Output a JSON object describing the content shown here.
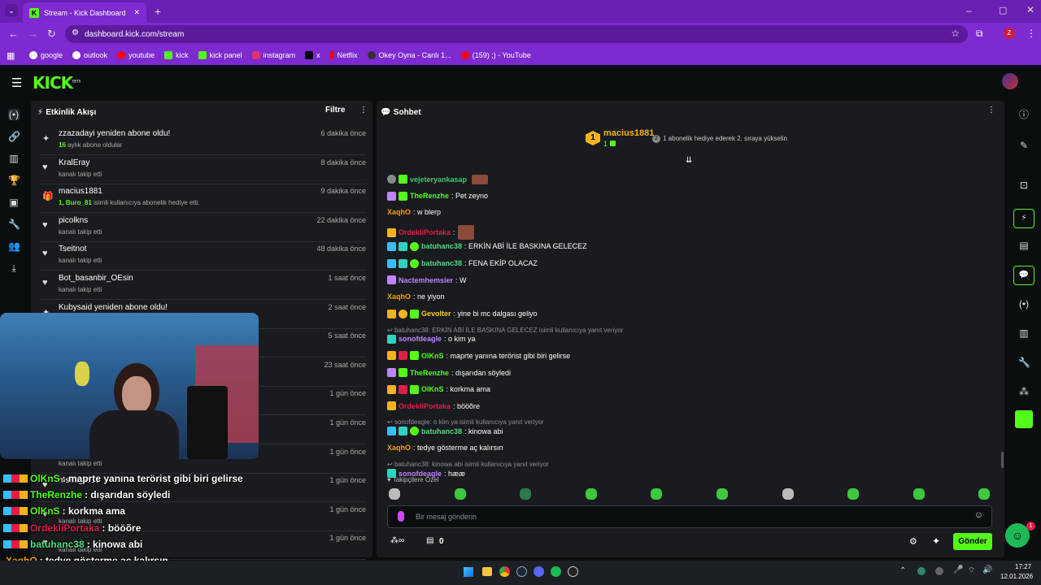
{
  "browser": {
    "tab_title": "Stream - Kick Dashboard",
    "url": "dashboard.kick.com/stream",
    "profile_initial": "Z",
    "bookmarks": [
      "google",
      "outlook",
      "youtube",
      "kick",
      "kick panel",
      "instagram",
      "x",
      "Netflix",
      "Okey Oyna - Canlı 1...",
      "(159) ;) - YouTube"
    ]
  },
  "brand": {
    "logo": "KICK",
    "beta": "BETA",
    "accent": "#53fc18"
  },
  "activity": {
    "title": "Etkinlik Akışı",
    "filter_label": "Filtre",
    "items": [
      {
        "name": "zzazadayi yeniden abone oldu!",
        "sub_strong": "16",
        "sub": " aylık abone oldular",
        "time": "6 dakika önce",
        "icon": "sparkle"
      },
      {
        "name": "KralEray",
        "sub_strong": "",
        "sub": "kanalı takip etti",
        "time": "8 dakika önce",
        "icon": "heart"
      },
      {
        "name": "macius1881",
        "sub_strong": "1, Buro_81",
        "sub": " isimli kullanıcıya abonelik hediye etti.",
        "time": "9 dakika önce",
        "icon": "gift"
      },
      {
        "name": "picolkns",
        "sub_strong": "",
        "sub": "kanalı takip etti",
        "time": "22 dakika önce",
        "icon": "heart"
      },
      {
        "name": "Tseitnot",
        "sub_strong": "",
        "sub": "kanalı takip etti",
        "time": "48 dakika önce",
        "icon": "heart"
      },
      {
        "name": "Bot_basanbir_OEsin",
        "sub_strong": "",
        "sub": "kanalı takip etti",
        "time": "1 saat önce",
        "icon": "heart"
      },
      {
        "name": "Kubysaid yeniden abone oldu!",
        "sub_strong": "",
        "sub": "",
        "time": "2 saat önce",
        "icon": "sparkle"
      },
      {
        "name": "",
        "sub_strong": "",
        "sub": "",
        "time": "5 saat önce",
        "icon": "heart"
      },
      {
        "name": "",
        "sub_strong": "",
        "sub": "",
        "time": "23 saat önce",
        "icon": "heart"
      },
      {
        "name": "",
        "sub_strong": "",
        "sub": "",
        "time": "1 gün önce",
        "icon": "heart"
      },
      {
        "name": "",
        "sub_strong": "",
        "sub": "",
        "time": "1 gün önce",
        "icon": "heart"
      },
      {
        "name": "",
        "sub_strong": "",
        "sub": "kanalı takip etti",
        "time": "1 gün önce",
        "icon": "heart"
      },
      {
        "name": "mstrsgim12",
        "sub_strong": "",
        "sub": "",
        "time": "1 gün önce",
        "icon": "heart"
      },
      {
        "name": "",
        "sub_strong": "",
        "sub": "kanalı takip etti",
        "time": "1 gün önce",
        "icon": "heart"
      },
      {
        "name": "",
        "sub_strong": "",
        "sub": "kanalı takip etti",
        "time": "1 gün önce",
        "icon": "heart"
      }
    ]
  },
  "chat": {
    "title": "Sohbet",
    "top_gifter": {
      "name": "macius1881",
      "rank": "1",
      "count": "1",
      "message": "1 abonelik hediye ederek 2. sıraya yükselin"
    },
    "messages": [
      {
        "user": "vejeteryankasap",
        "color": "#3ec86b",
        "text": "",
        "type": "msg"
      },
      {
        "user": "TheRenzhe",
        "color": "#53fc18",
        "text": ": Pet zeyno",
        "type": "msg"
      },
      {
        "user": "XaqhO",
        "color": "#f59e0b",
        "text": ": w blerp",
        "type": "msg"
      },
      {
        "user": "OrdekliPortaka",
        "color": "#e11d48",
        "text": ":",
        "type": "msg"
      },
      {
        "user": "batuhanc38",
        "color": "#4ade80",
        "text": ": ERKİN ABİ İLE BASKINA GELECEZ",
        "type": "msg"
      },
      {
        "user": "batuhanc38",
        "color": "#4ade80",
        "text": ": FENA EKİP OLACAZ",
        "type": "msg"
      },
      {
        "user": "Nactemhemsier",
        "color": "#c084fc",
        "text": ": W",
        "type": "msg"
      },
      {
        "user": "XaqhO",
        "color": "#f59e0b",
        "text": ": ne yiyon",
        "type": "msg"
      },
      {
        "user": "Gevolter",
        "color": "#facc15",
        "text": ": yine bi mc dalgası geliyo",
        "type": "msg"
      },
      {
        "user": "",
        "color": "",
        "text": "batuhanc38: ERKİN ABİ İLE BASKINA GELECEZ isimli kullanıcıya yanıt veriyor",
        "type": "reply"
      },
      {
        "user": "sonofdeagle",
        "color": "#c084fc",
        "text": ": o kim ya",
        "type": "msg"
      },
      {
        "user": "OlKnS",
        "color": "#53fc18",
        "text": ": maprte yanına terörist gibi biri gelirse",
        "type": "msg"
      },
      {
        "user": "TheRenzhe",
        "color": "#53fc18",
        "text": ": dışarıdan söyledi",
        "type": "msg"
      },
      {
        "user": "OlKnS",
        "color": "#53fc18",
        "text": ": korkma ama",
        "type": "msg"
      },
      {
        "user": "OrdekliPortaka",
        "color": "#e11d48",
        "text": ": bööõre",
        "type": "msg"
      },
      {
        "user": "",
        "color": "",
        "text": "sonofdeagle: o kim ya isimli kullanıcıya yanıt veriyor",
        "type": "reply"
      },
      {
        "user": "batuhanc38",
        "color": "#4ade80",
        "text": ": kinowa abi",
        "type": "msg"
      },
      {
        "user": "XaqhO",
        "color": "#f59e0b",
        "text": ": tedye gösterme aç kalırsın",
        "type": "msg"
      },
      {
        "user": "",
        "color": "",
        "text": "batuhanc38: kinowa abi isimli kullanıcıya yanıt veriyor",
        "type": "reply"
      },
      {
        "user": "sonofdeagle",
        "color": "#c084fc",
        "text": ": hææ",
        "type": "msg"
      }
    ],
    "emote_section": "Takipçilere Özel",
    "input_placeholder": "Bir mesaj gönderin",
    "points": "0",
    "send_label": "Gönder"
  },
  "overlay_chat": [
    {
      "user": "OlKnS",
      "color": "#53fc18",
      "text": ": maprte yanına terörist gibi biri gelirse"
    },
    {
      "user": "TheRenzhe",
      "color": "#53fc18",
      "text": ": dışarıdan söyledi"
    },
    {
      "user": "OlKnS",
      "color": "#53fc18",
      "text": ": korkma ama"
    },
    {
      "user": "OrdekliPortaka",
      "color": "#e11d48",
      "text": ": bööõre"
    },
    {
      "user": "batuhanc38",
      "color": "#4ade80",
      "text": ": kinowa abi"
    },
    {
      "user": "XaqhO",
      "color": "#f59e0b",
      "text": ": tedye gösterme aç kalırsın"
    },
    {
      "user": "sonofdeagle",
      "color": "#c084fc",
      "text": ": hææ"
    }
  ],
  "taskbar": {
    "time": "17:27",
    "date": "12.01.2026",
    "notification_count": "1"
  }
}
